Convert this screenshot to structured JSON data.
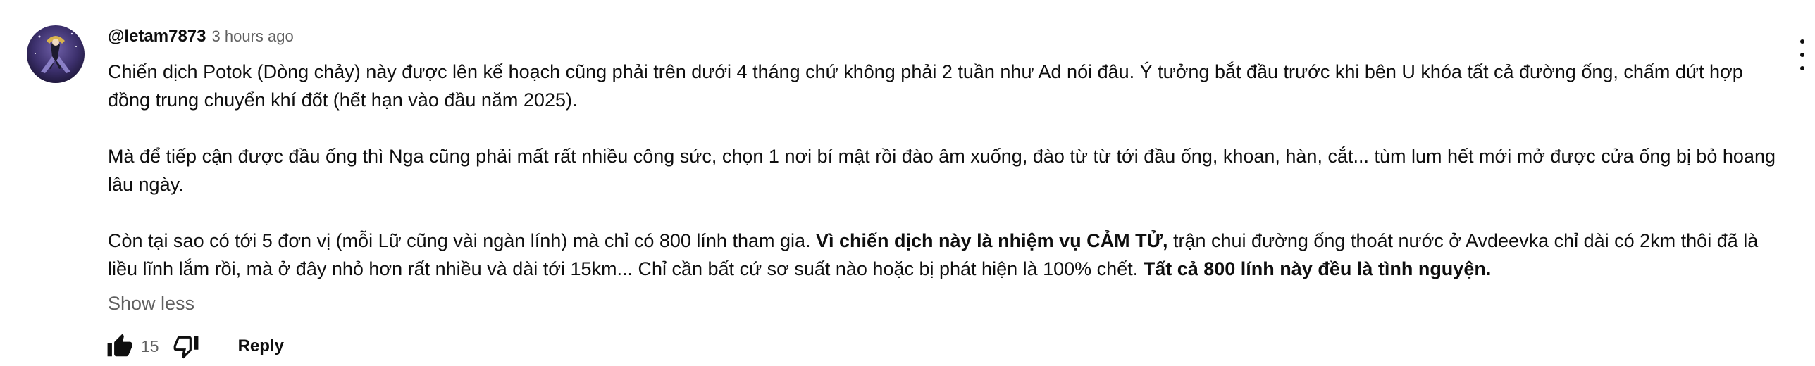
{
  "comment": {
    "author": "@letam7873",
    "time": "3 hours ago",
    "paragraphs": [
      [
        {
          "text": "Chiến dịch Potok (Dòng chảy) này được lên kế hoạch cũng phải trên dưới 4 tháng chứ không phải 2 tuần như Ad nói đâu. Ý tưởng bắt đầu trước khi bên U khóa tất cả đường ống, chấm dứt hợp đồng trung chuyển khí đốt (hết hạn vào đầu năm 2025).",
          "bold": false
        }
      ],
      [
        {
          "text": "Mà để tiếp cận được đầu ống thì Nga cũng phải mất rất nhiều công sức, chọn 1 nơi bí mật rồi đào âm xuống, đào từ từ tới đầu ống, khoan, hàn, cắt... tùm lum hết mới mở được cửa ống bị bỏ hoang lâu ngày.",
          "bold": false
        }
      ],
      [
        {
          "text": "Còn tại sao có tới 5 đơn vị (mỗi Lữ cũng vài ngàn lính) mà chỉ có 800 lính tham gia. ",
          "bold": false
        },
        {
          "text": "Vì chiến dịch này là nhiệm vụ CẢM TỬ,",
          "bold": true
        },
        {
          "text": " trận chui đường ống thoát nước ở Avdeevka chỉ dài có 2km thôi đã là liều lĩnh lắm rồi, mà ở đây nhỏ hơn rất nhiều và dài tới 15km... Chỉ cần bất cứ sơ suất nào hoặc bị phát hiện là 100% chết. ",
          "bold": false
        },
        {
          "text": "Tất cả 800 lính này đều là tình nguyện.",
          "bold": true
        }
      ]
    ],
    "show_less_label": "Show less",
    "like_count": "15",
    "reply_label": "Reply"
  },
  "icons": {
    "like": "thumb-up-icon",
    "dislike": "thumb-down-icon",
    "menu": "more-vert-icon"
  },
  "colors": {
    "text_primary": "#0f0f0f",
    "text_secondary": "#606060",
    "background": "#ffffff"
  }
}
